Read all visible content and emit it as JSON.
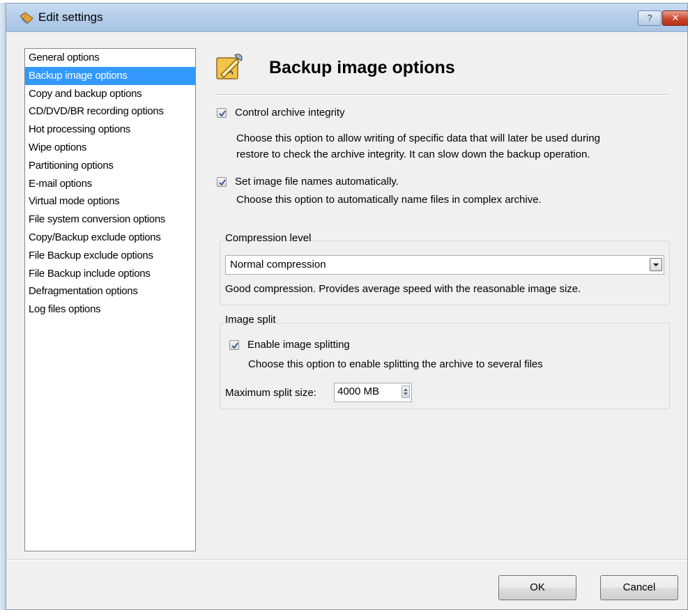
{
  "window": {
    "title": "Edit settings",
    "help_label": "?",
    "close_label": "✕"
  },
  "sidebar": {
    "items": [
      {
        "label": "General options",
        "selected": false
      },
      {
        "label": "Backup image options",
        "selected": true
      },
      {
        "label": "Copy and backup options",
        "selected": false
      },
      {
        "label": "CD/DVD/BR recording options",
        "selected": false
      },
      {
        "label": "Hot processing options",
        "selected": false
      },
      {
        "label": "Wipe options",
        "selected": false
      },
      {
        "label": "Partitioning options",
        "selected": false
      },
      {
        "label": "E-mail options",
        "selected": false
      },
      {
        "label": "Virtual mode options",
        "selected": false
      },
      {
        "label": "File system conversion options",
        "selected": false
      },
      {
        "label": "Copy/Backup exclude options",
        "selected": false
      },
      {
        "label": "File Backup exclude options",
        "selected": false
      },
      {
        "label": "File Backup include options",
        "selected": false
      },
      {
        "label": "Defragmentation options",
        "selected": false
      },
      {
        "label": "Log files options",
        "selected": false
      }
    ]
  },
  "panel": {
    "title": "Backup image options",
    "control_integrity": {
      "label": "Control archive integrity",
      "checked": true,
      "desc_line1": "Choose this option to allow writing of specific data that will later be used during",
      "desc_line2": "restore to check the archive integrity. It can slow down the backup operation."
    },
    "auto_names": {
      "label": "Set image file names automatically.",
      "checked": true,
      "desc": "Choose this option to automatically name files in complex archive."
    },
    "compression": {
      "group_label": "Compression level",
      "selected": "Normal compression",
      "desc": "Good compression. Provides average speed with the reasonable image size."
    },
    "split": {
      "group_label": "Image split",
      "enable_label": "Enable image splitting",
      "checked": true,
      "desc": "Choose this option to enable splitting the archive to several files",
      "max_label": "Maximum split size:",
      "max_value": "4000 MB"
    }
  },
  "buttons": {
    "ok": "OK",
    "cancel": "Cancel"
  },
  "colors": {
    "selection": "#3399ff",
    "titlebar": "#b5cdea",
    "close": "#c8462c"
  },
  "icons": {
    "title": "settings-tag-icon",
    "header": "wrench-pencil-icon",
    "checkbox": "checkmark-icon",
    "combo": "chevron-down-icon",
    "spin": "spin-arrows-icon"
  }
}
